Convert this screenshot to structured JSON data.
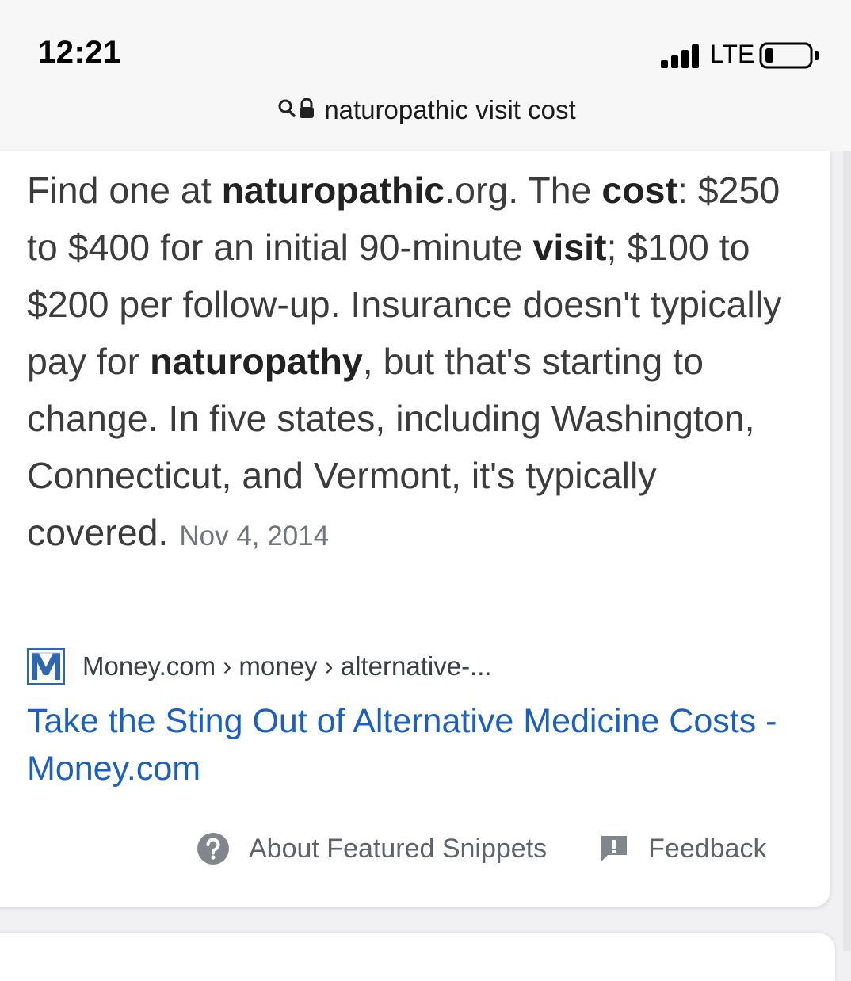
{
  "status_bar": {
    "time": "12:21",
    "network": "LTE",
    "signal_icon": "cellular-signal-icon",
    "battery_icon": "battery-icon",
    "battery_level": 0.2
  },
  "address_bar": {
    "query": "naturopathic visit cost",
    "search_icon": "search-icon",
    "lock_icon": "lock-icon"
  },
  "snippet": {
    "s1": "Find one at ",
    "b1": "naturopathic",
    "s2": ".org. The ",
    "b2": "cost",
    "s3": ": $250 to $400 for an initial 90-minute ",
    "b3": "visit",
    "s4": "; $100 to $200 per follow-up. Insurance doesn't typically pay for ",
    "b4": "naturopathy",
    "s5": ", but that's starting to change. In five states, including Washington, Connecticut, and Vermont, it's typically covered.",
    "date": "Nov 4, 2014"
  },
  "source": {
    "favicon_icon": "money-logo-icon",
    "breadcrumb": "Money.com › money › alternative-..."
  },
  "result": {
    "title": "Take the Sting Out of Alternative Medicine Costs - Money.com"
  },
  "footer": {
    "about_label": "About Featured Snippets",
    "about_icon": "help-circle-icon",
    "feedback_label": "Feedback",
    "feedback_icon": "feedback-icon"
  },
  "colors": {
    "link": "#1a5fc8",
    "text": "#3c3c3c",
    "muted": "#70757a"
  }
}
